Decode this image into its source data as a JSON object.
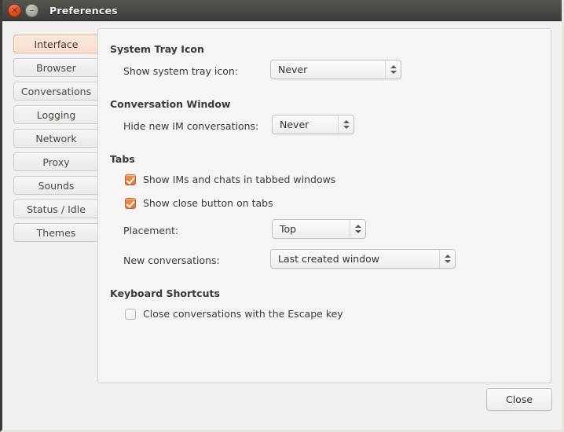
{
  "window": {
    "title": "Preferences",
    "controls": [
      {
        "name": "close",
        "icon": "close-icon",
        "glyph": "✕"
      },
      {
        "name": "minimize",
        "icon": "minimize-icon",
        "glyph": "–"
      }
    ]
  },
  "sidebar": {
    "items": [
      {
        "label": "Interface",
        "selected": true
      },
      {
        "label": "Browser",
        "selected": false
      },
      {
        "label": "Conversations",
        "selected": false
      },
      {
        "label": "Logging",
        "selected": false
      },
      {
        "label": "Network",
        "selected": false
      },
      {
        "label": "Proxy",
        "selected": false
      },
      {
        "label": "Sounds",
        "selected": false
      },
      {
        "label": "Status / Idle",
        "selected": false
      },
      {
        "label": "Themes",
        "selected": false
      }
    ]
  },
  "panel": {
    "system_tray": {
      "title": "System Tray Icon",
      "show_tray_label": "Show system tray icon:",
      "show_tray_value": "Never"
    },
    "conversation_window": {
      "title": "Conversation Window",
      "hide_im_label": "Hide new IM conversations:",
      "hide_im_value": "Never"
    },
    "tabs": {
      "title": "Tabs",
      "tabbed_windows_label": "Show IMs and chats in tabbed windows",
      "tabbed_windows_checked": true,
      "close_button_label": "Show close button on tabs",
      "close_button_checked": true,
      "placement_label": "Placement:",
      "placement_value": "Top",
      "new_conversations_label": "New conversations:",
      "new_conversations_value": "Last created window"
    },
    "keyboard_shortcuts": {
      "title": "Keyboard Shortcuts",
      "escape_label": "Close conversations with the Escape key",
      "escape_checked": false
    }
  },
  "footer": {
    "close_label": "Close"
  },
  "colors": {
    "titlebar": "#4b4945",
    "accent_orange": "#e2763a",
    "selected_tab_bg": "#f8ddcd",
    "selected_tab_border": "#e8a98a",
    "panel_bg": "#f6f5f4",
    "window_bg": "#f2f1f0"
  }
}
